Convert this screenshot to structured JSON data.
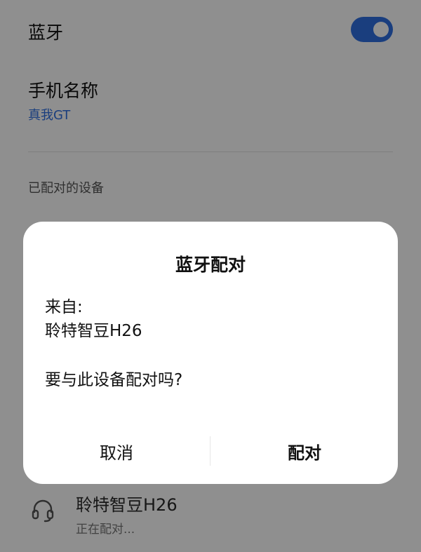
{
  "settings": {
    "bluetooth_label": "蓝牙",
    "bluetooth_on": true,
    "phone_name_label": "手机名称",
    "phone_name_value": "真我GT",
    "paired_section_label": "已配对的设备",
    "device": {
      "icon": "headset-icon",
      "name": "聆特智豆H26",
      "status": "正在配对..."
    }
  },
  "dialog": {
    "title": "蓝牙配对",
    "from_label": "来自:",
    "device_name": "聆特智豆H26",
    "question": "要与此设备配对吗?",
    "cancel_label": "取消",
    "pair_label": "配对"
  },
  "colors": {
    "accent": "#2f6fe0",
    "scrim": "#00000070",
    "dialog_bg": "#ffffff"
  }
}
